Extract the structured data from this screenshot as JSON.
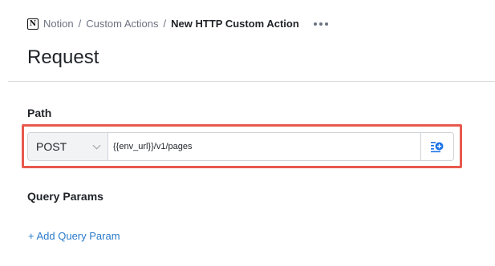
{
  "breadcrumb": {
    "items": [
      "Notion",
      "Custom Actions"
    ],
    "separator": "/",
    "current": "New HTTP Custom Action"
  },
  "header": {
    "title": "Request"
  },
  "path": {
    "label": "Path",
    "method": "POST",
    "url": "{{env_url}}/v1/pages",
    "highlight_color": "#e8594d"
  },
  "query_params": {
    "label": "Query Params",
    "add_link": "+ Add Query Param"
  },
  "colors": {
    "link": "#2a7ac9",
    "icon_blue": "#1a73e8"
  },
  "icons": {
    "logo": "notion-logo-icon",
    "more": "more-horizontal-icon",
    "insert": "insert-variable-icon"
  }
}
